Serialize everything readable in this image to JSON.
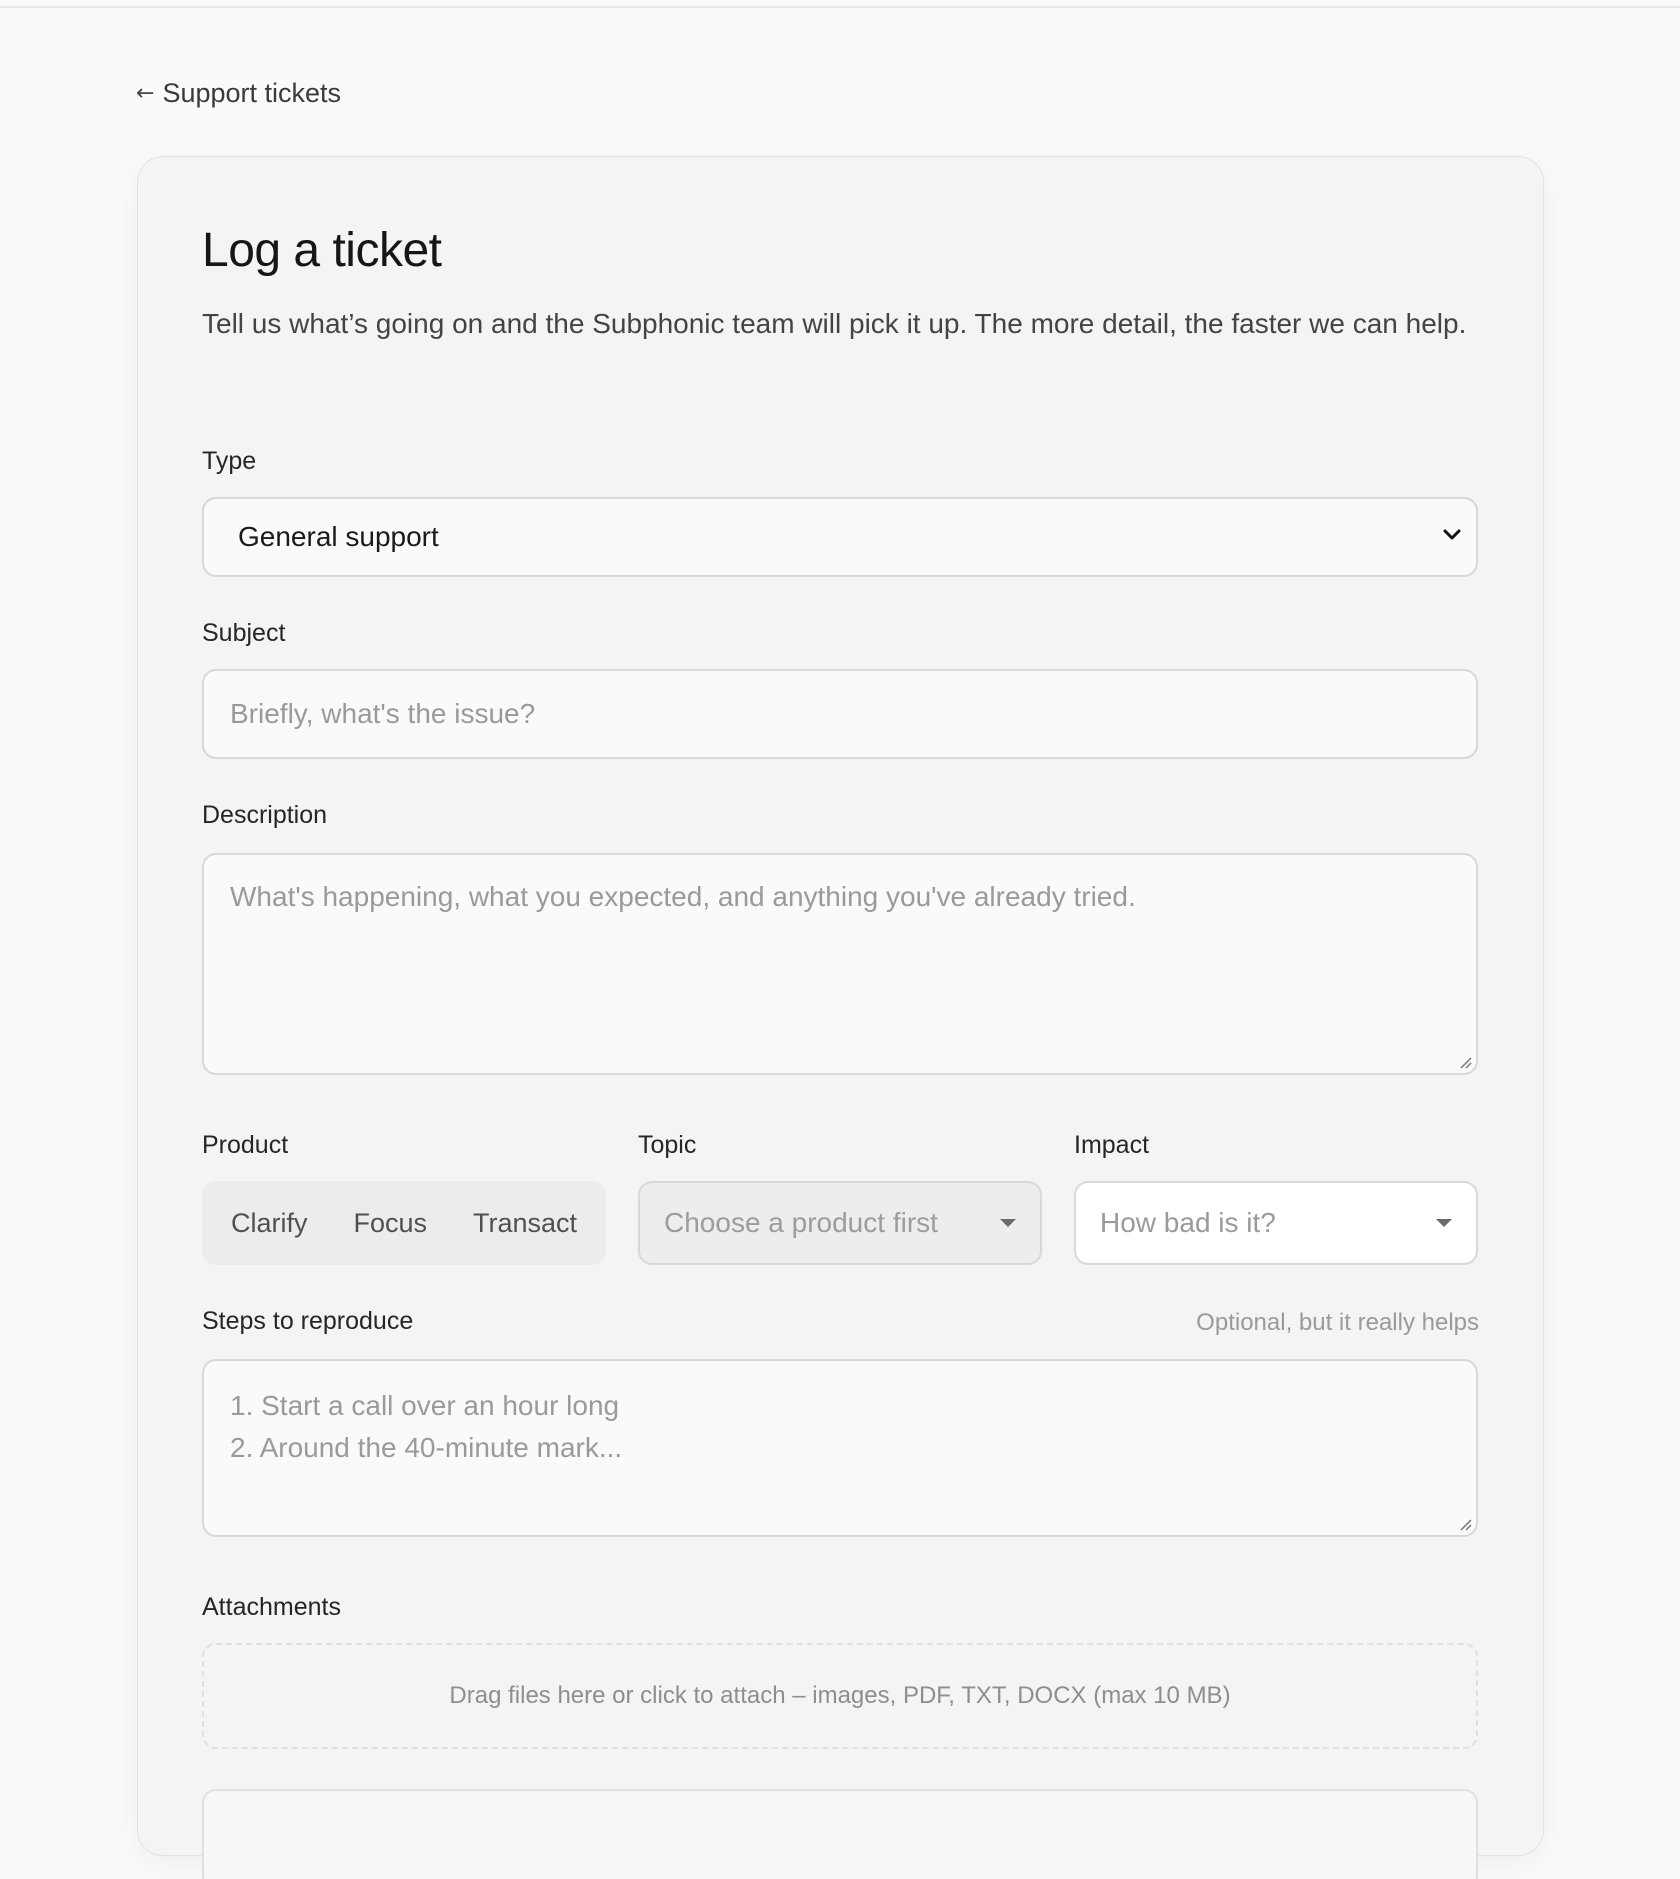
{
  "nav": {
    "back_arrow": "←",
    "back_label": "Support tickets"
  },
  "form": {
    "title": "Log a ticket",
    "intro": "Tell us what’s going on and the Subphonic team will pick it up. The more detail, the faster we can help.",
    "type": {
      "label": "Type",
      "value": "General support"
    },
    "subject": {
      "label": "Subject",
      "placeholder": "Briefly, what's the issue?"
    },
    "description": {
      "label": "Description",
      "placeholder": "What's happening, what you expected, and anything you've already tried."
    },
    "product": {
      "label": "Product",
      "options": [
        "Clarify",
        "Focus",
        "Transact"
      ]
    },
    "topic": {
      "label": "Topic",
      "placeholder": "Choose a product first"
    },
    "impact": {
      "label": "Impact",
      "placeholder": "How bad is it?"
    },
    "steps": {
      "label": "Steps to reproduce",
      "hint": "Optional, but it really helps",
      "placeholder_line1": "1. Start a call over an hour long",
      "placeholder_line2": "2. Around the 40-minute mark..."
    },
    "attachments": {
      "label": "Attachments",
      "dropzone_text": "Drag files here or click to attach – images, PDF, TXT, DOCX (max 10 MB)"
    }
  },
  "icons": {
    "back": "arrow-left-icon",
    "type_select": "chevron-down-icon",
    "topic_select": "caret-down-icon",
    "impact_select": "caret-down-icon",
    "resize": "resize-handle-icon"
  },
  "colors": {
    "page_bg": "#fafafa",
    "card_bg": "#f4f4f4",
    "border": "#d8d8d8",
    "placeholder": "#9a9a9a",
    "text": "#1c1c1c"
  }
}
